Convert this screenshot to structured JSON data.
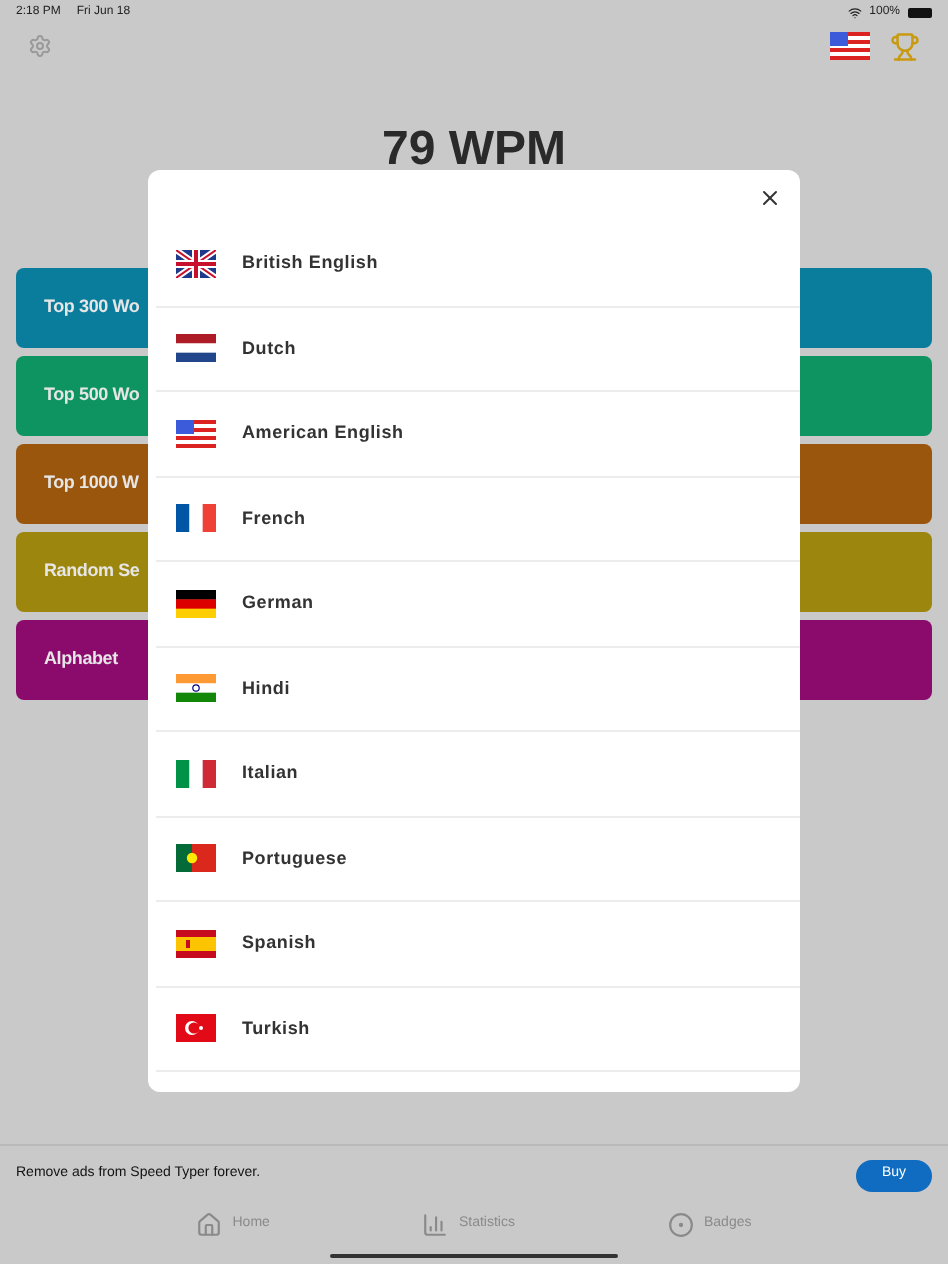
{
  "status_bar": {
    "time": "2:18 PM",
    "date": "Fri Jun 18",
    "battery": "100%"
  },
  "score": "79 WPM",
  "categories": [
    {
      "label": "Top 300 Wo",
      "color": "#0b7d9c"
    },
    {
      "label": "Top 500 Wo",
      "color": "#0d9460"
    },
    {
      "label": "Top 1000 W",
      "color": "#9b560d"
    },
    {
      "label": "Random Se",
      "color": "#9c860d"
    },
    {
      "label": "Alphabet",
      "color": "#8a0b6c"
    }
  ],
  "languages": [
    {
      "label": "British English",
      "kind": "gb"
    },
    {
      "label": "Dutch",
      "kind": "nl"
    },
    {
      "label": "American English",
      "kind": "us"
    },
    {
      "label": "French",
      "kind": "fr"
    },
    {
      "label": "German",
      "kind": "de"
    },
    {
      "label": "Hindi",
      "kind": "in"
    },
    {
      "label": "Italian",
      "kind": "it"
    },
    {
      "label": "Portuguese",
      "kind": "pt"
    },
    {
      "label": "Spanish",
      "kind": "es"
    },
    {
      "label": "Turkish",
      "kind": "tr"
    }
  ],
  "ad": {
    "text": "Remove ads from Speed Typer forever.",
    "button": "Buy"
  },
  "tabs": [
    {
      "label": "Home",
      "kind": "home"
    },
    {
      "label": "Statistics",
      "kind": "stats"
    },
    {
      "label": "Badges",
      "kind": "badge"
    }
  ]
}
